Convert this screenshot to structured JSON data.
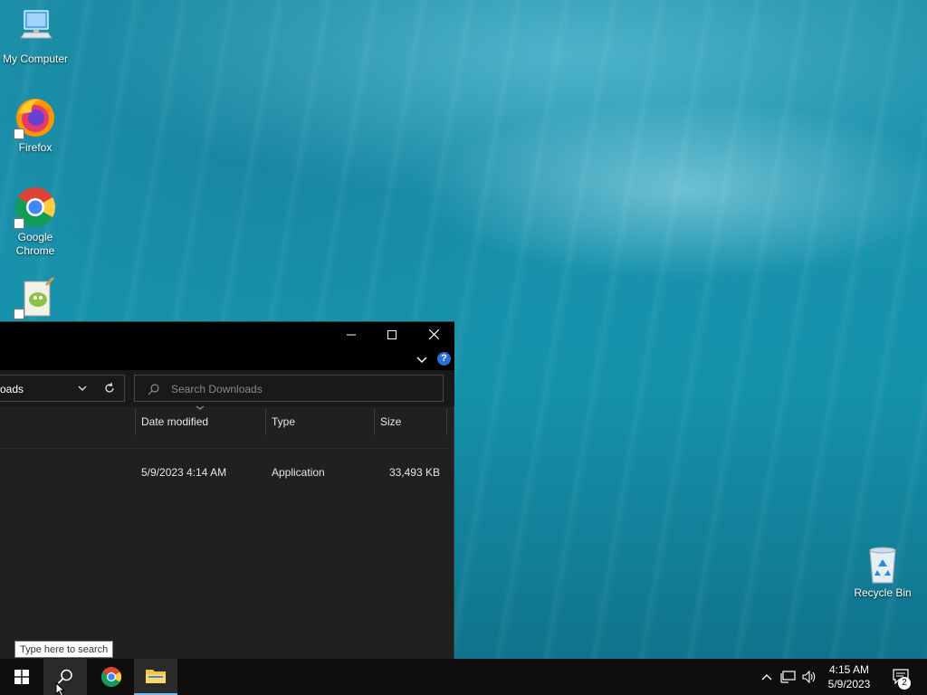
{
  "desktop": {
    "icons": [
      {
        "label": "My Computer"
      },
      {
        "label": "Firefox"
      },
      {
        "label": "Google Chrome"
      },
      {
        "label": ""
      },
      {
        "label": "Recycle Bin"
      }
    ]
  },
  "explorer": {
    "address_fragment": "oads",
    "search_placeholder": "Search Downloads",
    "columns": [
      "Date modified",
      "Type",
      "Size"
    ],
    "rows": [
      {
        "date": "5/9/2023 4:14 AM",
        "type": "Application",
        "size": "33,493 KB"
      }
    ]
  },
  "taskbar": {
    "search_tooltip": "Type here to search",
    "clock_time": "4:15 AM",
    "clock_date": "5/9/2023",
    "notification_count": "2"
  },
  "colors": {
    "window_bg": "#202020",
    "titlebar_bg": "#000000",
    "taskbar_bg": "#0e0e0e",
    "accent_underline": "#76b9ed",
    "help_badge": "#2b6ed4"
  }
}
